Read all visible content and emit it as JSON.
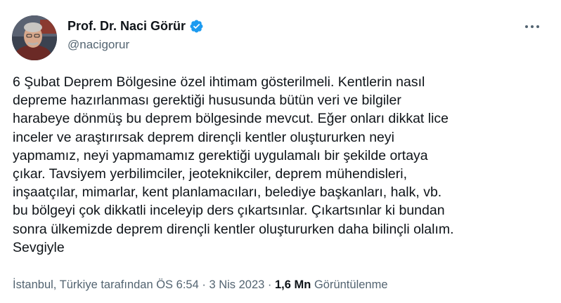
{
  "author": {
    "display_name": "Prof. Dr. Naci Görür",
    "handle": "@nacigorur",
    "verified_icon": "verified-badge-icon",
    "verified_color": "#1d9bf0"
  },
  "more_icon": "more-horizontal-icon",
  "tweet": {
    "lines": [
      "6 Şubat Deprem Bölgesine özel ihtimam gösterilmeli. Kentlerin nasıl",
      "depreme hazırlanması gerektiği hususunda bütün veri ve bilgiler",
      "harabeye dönmüş bu deprem bölgesinde mevcut. Eğer onları dikkat lice",
      "inceler ve araştırırsak deprem dirençli kentler oluştururken neyi",
      "yapmamız, neyi yapmamamız gerektiği uygulamalı bir şekilde ortaya",
      "çıkar. Tavsiyem yerbilimciler, jeoteknikciler, deprem mühendisleri,",
      "inşaatçılar, mimarlar, kent planlamacıları, belediye başkanları, halk, vb.",
      "bu bölgeyi çok dikkatli inceleyip ders çıkartsınlar. Çıkartsınlar ki bundan",
      "sonra ülkemizde deprem dirençli kentler oluştururken daha bilinçli olalım.",
      "Sevgiyle"
    ]
  },
  "meta": {
    "location_time": "İstanbul, Türkiye tarafından ÖS 6:54",
    "separator": " · ",
    "date": "3 Nis 2023",
    "views_count": "1,6 Mn",
    "views_label": "Görüntülenme"
  },
  "colors": {
    "text": "#0f1419",
    "secondary": "#536471",
    "background": "#ffffff"
  }
}
